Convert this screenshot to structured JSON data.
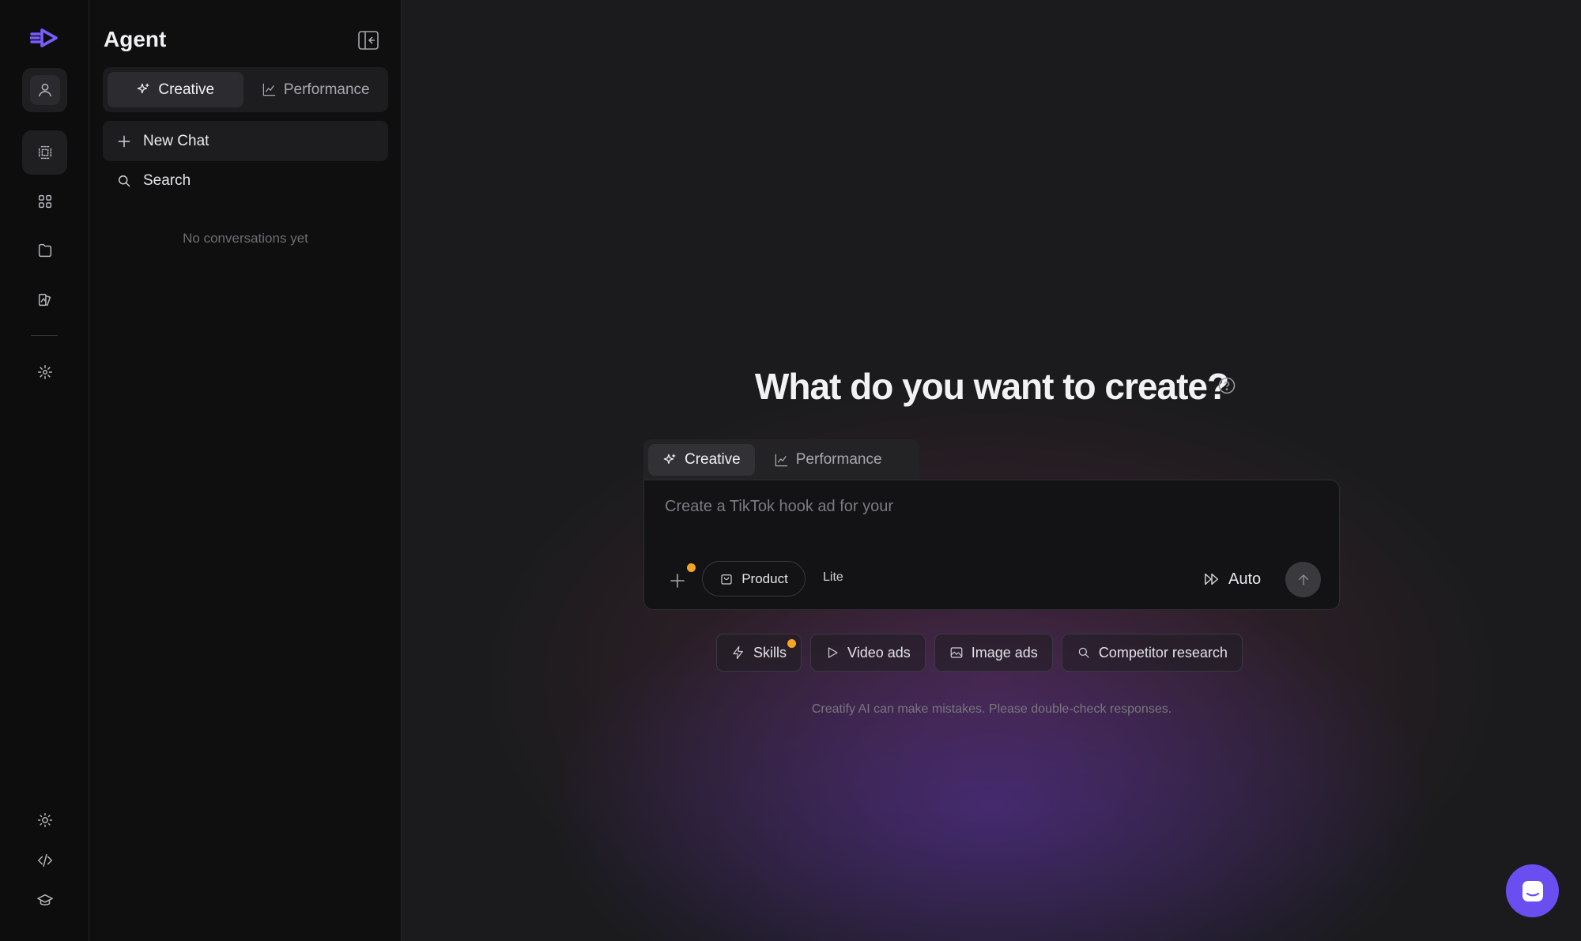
{
  "rail": {
    "items": [
      {
        "name": "profile-icon",
        "active": true
      },
      {
        "name": "agent-chat-icon",
        "active": true
      },
      {
        "name": "apps-grid-icon",
        "active": false
      },
      {
        "name": "folder-icon",
        "active": false
      },
      {
        "name": "library-icon",
        "active": false
      },
      {
        "name": "ai-spark-icon",
        "active": false
      }
    ],
    "bottom": [
      "sun-icon",
      "code-icon",
      "graduation-cap-icon"
    ]
  },
  "panel": {
    "title": "Agent",
    "tabs": [
      {
        "label": "Creative",
        "icon": "sparkle-icon",
        "active": true
      },
      {
        "label": "Performance",
        "icon": "chart-line-icon",
        "active": false
      }
    ],
    "new_chat_label": "New Chat",
    "search_label": "Search",
    "empty_message": "No conversations yet"
  },
  "main": {
    "heading": "What do you want to create?",
    "mode_tabs": [
      {
        "label": "Creative",
        "icon": "sparkle-icon",
        "active": true
      },
      {
        "label": "Performance",
        "icon": "chart-line-icon",
        "active": false
      }
    ],
    "composer": {
      "placeholder": "Create a TikTok hook ad for your",
      "product_label": "Product",
      "tier_label": "Lite",
      "mode_label": "Auto"
    },
    "chips": [
      {
        "label": "Skills",
        "icon": "lightning-icon",
        "badge": true
      },
      {
        "label": "Video ads",
        "icon": "play-icon",
        "badge": false
      },
      {
        "label": "Image ads",
        "icon": "image-icon",
        "badge": false
      },
      {
        "label": "Competitor research",
        "icon": "search-icon",
        "badge": false
      }
    ],
    "disclaimer": "Creatify AI can make mistakes. Please double-check responses."
  },
  "colors": {
    "accent": "#6b4ef0",
    "logo": "#7b5cff",
    "badge": "#f5a524",
    "background": "#1b1b1d",
    "panel": "#0f0f10"
  }
}
